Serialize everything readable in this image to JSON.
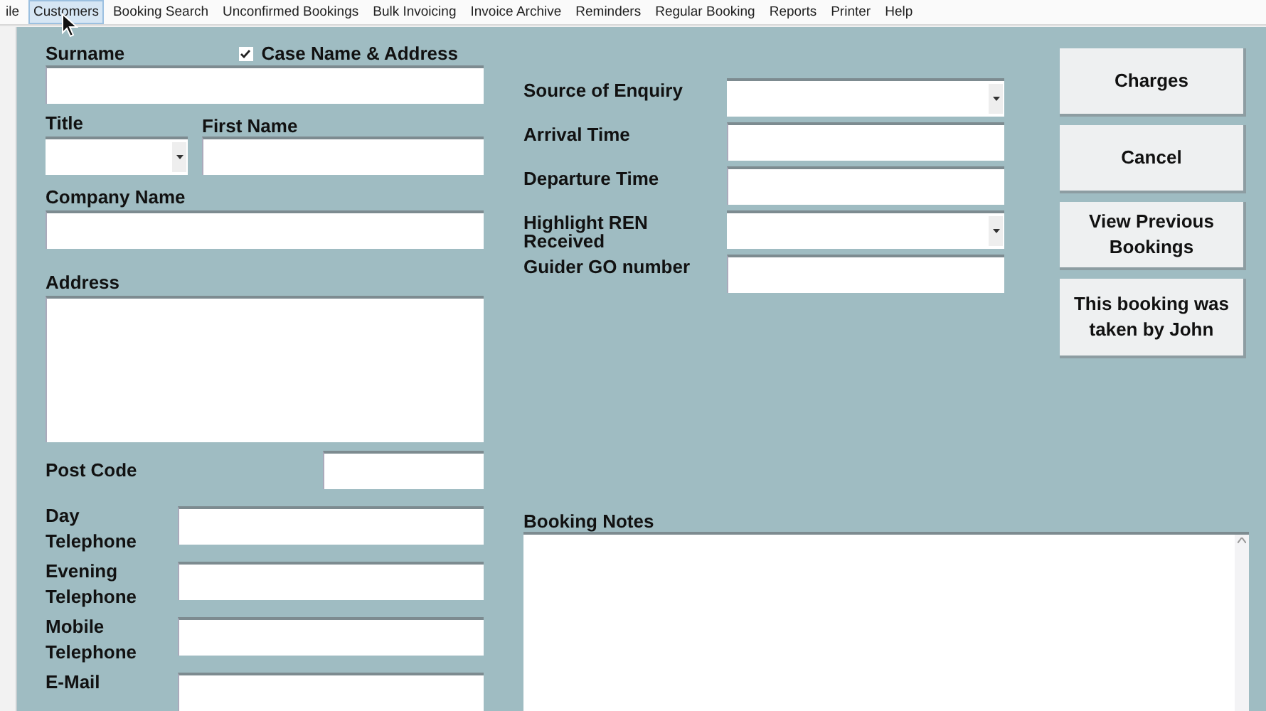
{
  "menu": [
    {
      "label": "ile",
      "selected": false
    },
    {
      "label": "Customers",
      "selected": true
    },
    {
      "label": "Booking Search",
      "selected": false
    },
    {
      "label": "Unconfirmed Bookings",
      "selected": false
    },
    {
      "label": "Bulk Invoicing",
      "selected": false
    },
    {
      "label": "Invoice Archive",
      "selected": false
    },
    {
      "label": "Reminders",
      "selected": false
    },
    {
      "label": "Regular Booking",
      "selected": false
    },
    {
      "label": "Reports",
      "selected": false
    },
    {
      "label": "Printer",
      "selected": false
    },
    {
      "label": "Help",
      "selected": false
    }
  ],
  "customer": {
    "surname": {
      "label": "Surname"
    },
    "case_option": {
      "label": "Case Name & Address",
      "checked": true
    },
    "title": {
      "label": "Title"
    },
    "first_name": {
      "label": "First Name"
    },
    "company_name": {
      "label": "Company Name"
    },
    "address": {
      "label": "Address"
    },
    "post_code": {
      "label": "Post Code"
    },
    "contacts": [
      {
        "label": "Day Telephone"
      },
      {
        "label": "Evening Telephone"
      },
      {
        "label": "Mobile Telephone"
      },
      {
        "label": "E-Mail"
      }
    ]
  },
  "enquiry_fields": [
    {
      "label": "Source of Enquiry",
      "kind": "select"
    },
    {
      "label": "Arrival Time",
      "kind": "text"
    },
    {
      "label": "Departure Time",
      "kind": "text"
    },
    {
      "label": "Highlight REN Received",
      "kind": "select"
    },
    {
      "label": "Guider GO number",
      "kind": "text"
    }
  ],
  "booking_notes": {
    "label": "Booking Notes"
  },
  "buttons": [
    "Charges",
    "Cancel",
    "View Previous Bookings",
    "This booking was taken by John"
  ]
}
